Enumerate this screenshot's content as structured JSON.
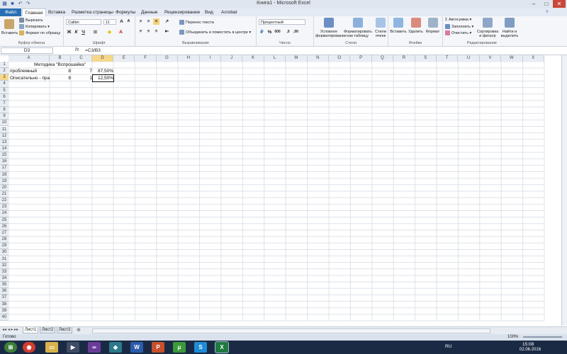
{
  "window": {
    "title": "Книга1 - Microsoft Excel"
  },
  "menu": [
    "Файл",
    "Главная",
    "Вставка",
    "Разметка страницы",
    "Формулы",
    "Данные",
    "Рецензирование",
    "Вид",
    "Acrobat"
  ],
  "ribbon": {
    "clipboard": {
      "paste": "Вставить",
      "cut": "Вырезать",
      "copy": "Копировать",
      "format_painter": "Формат по образцу",
      "label": "Буфер обмена"
    },
    "font": {
      "name": "Calibri",
      "size": "11",
      "bold": "Ж",
      "italic": "К",
      "underline": "Ч",
      "label": "Шрифт"
    },
    "alignment": {
      "wrap": "Перенос текста",
      "merge": "Объединить и поместить в центре",
      "label": "Выравнивание"
    },
    "number": {
      "format": "Процентный",
      "label": "Число"
    },
    "styles": {
      "conditional": "Условное форматирование",
      "as_table": "Форматировать как таблицу",
      "cell_styles": "Стили ячеек",
      "label": "Стили"
    },
    "cells": {
      "insert": "Вставить",
      "delete": "Удалить",
      "format": "Формат",
      "label": "Ячейки"
    },
    "editing": {
      "autosum": "Автосумма",
      "fill": "Заполнить",
      "clear": "Очистить",
      "sort": "Сортировка и фильтр",
      "find": "Найти и выделить",
      "label": "Редактирование"
    }
  },
  "formula_bar": {
    "name_box": "D3",
    "fx": "fx",
    "formula": "=C3/B3"
  },
  "columns": [
    "A",
    "B",
    "C",
    "D",
    "E",
    "F",
    "G",
    "H",
    "I",
    "J",
    "K",
    "L",
    "M",
    "N",
    "O",
    "P",
    "Q",
    "R",
    "S",
    "T",
    "U",
    "V",
    "W",
    "X"
  ],
  "rows": [
    "1",
    "2",
    "3",
    "4",
    "5",
    "6",
    "7",
    "8",
    "9",
    "10",
    "11",
    "12",
    "13",
    "14",
    "15",
    "16",
    "17",
    "18",
    "19",
    "20",
    "21",
    "22",
    "23",
    "24",
    "25",
    "26",
    "27",
    "28",
    "29",
    "30",
    "31",
    "32",
    "33",
    "34",
    "35",
    "36",
    "37",
    "38",
    "39",
    "40"
  ],
  "cells": {
    "A1": "Методика \"Вспрошайка\"",
    "A2": "проблемный",
    "B2": "8",
    "C2": "7",
    "D2": "87,50%",
    "A3": "Описательно - пра",
    "B3": "8",
    "C3": "1",
    "D3": "12,50%"
  },
  "sheets": [
    "Лист1",
    "Лист2",
    "Лист3"
  ],
  "status": {
    "ready": "Готово",
    "zoom": "100%"
  },
  "taskbar": {
    "lang": "RU",
    "time": "15:08",
    "date": "02.06.2016"
  },
  "colors": {
    "accent": "#2a6fb4",
    "taskbar": "#1b2a44"
  }
}
